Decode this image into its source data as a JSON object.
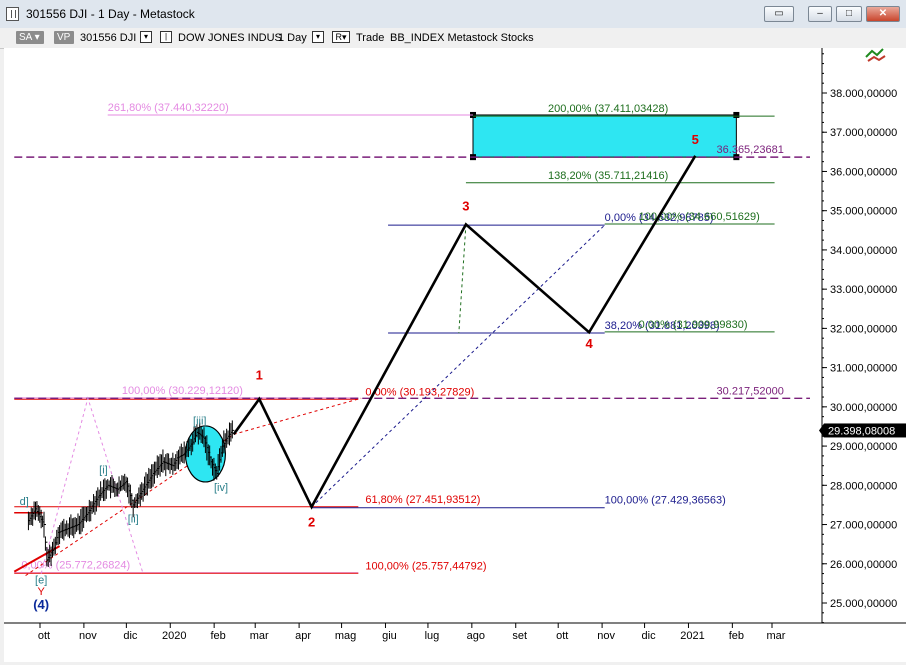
{
  "window": {
    "title": "301556 DJI - 1 Day - Metastock",
    "buttons": {
      "restore": "▭",
      "minimize": "–",
      "maximize": "□",
      "close": "✕"
    }
  },
  "toolbar": {
    "sa_label": "SA",
    "vp_label": "VP",
    "security": "301556 DJI",
    "security_name": "DOW JONES INDUS",
    "period": "1 Day",
    "r_label": "R",
    "trade_label": "Trade",
    "template": "BB_INDEX Metastock Stocks"
  },
  "colors": {
    "accent_cyan": "#2ee6f2",
    "wave_red": "#e00000",
    "wave_blue": "#0b2a9a",
    "fib_pink": "#e48ae2",
    "fib_green": "#1d6e1d",
    "fib_navy": "#1a1a8c"
  },
  "chart_data": {
    "type": "line",
    "title": "",
    "ylim": [
      24400000,
      39500000
    ],
    "y_ticks": [
      "25.000,00000",
      "26.000,00000",
      "27.000,00000",
      "28.000,00000",
      "29.000,00000",
      "30.000,00000",
      "31.000,00000",
      "32.000,00000",
      "33.000,00000",
      "34.000,00000",
      "35.000,00000",
      "36.000,00000",
      "37.000,00000",
      "38.000,00000"
    ],
    "y_tick_values": [
      25000000,
      26000000,
      27000000,
      28000000,
      29000000,
      30000000,
      31000000,
      32000000,
      33000000,
      34000000,
      35000000,
      36000000,
      37000000,
      38000000
    ],
    "x_ticks": [
      "ott",
      "nov",
      "dic",
      "2020",
      "feb",
      "mar",
      "apr",
      "mag",
      "giu",
      "lug",
      "ago",
      "set",
      "ott",
      "nov",
      "dic",
      "2021",
      "feb",
      "mar"
    ],
    "last_price": "29.398,08008",
    "price_series": [
      [
        "2019-09-20",
        27100000
      ],
      [
        "2019-09-25",
        27400000
      ],
      [
        "2019-10-01",
        27000000
      ],
      [
        "2019-10-03",
        26100000
      ],
      [
        "2019-10-08",
        26400000
      ],
      [
        "2019-10-11",
        26800000
      ],
      [
        "2019-10-18",
        26900000
      ],
      [
        "2019-10-25",
        27000000
      ],
      [
        "2019-11-01",
        27300000
      ],
      [
        "2019-11-08",
        27700000
      ],
      [
        "2019-11-15",
        28000000
      ],
      [
        "2019-11-22",
        27900000
      ],
      [
        "2019-11-28",
        28100000
      ],
      [
        "2019-12-03",
        27500000
      ],
      [
        "2019-12-10",
        27900000
      ],
      [
        "2019-12-17",
        28300000
      ],
      [
        "2019-12-24",
        28600000
      ],
      [
        "2019-12-31",
        28500000
      ],
      [
        "2020-01-03",
        28700000
      ],
      [
        "2020-01-08",
        28800000
      ],
      [
        "2020-01-14",
        29100000
      ],
      [
        "2020-01-17",
        29350000
      ],
      [
        "2020-01-22",
        29200000
      ],
      [
        "2020-01-27",
        28600000
      ],
      [
        "2020-01-31",
        28300000
      ],
      [
        "2020-02-04",
        29000000
      ],
      [
        "2020-02-07",
        29200000
      ],
      [
        "2020-02-11",
        29400000
      ]
    ],
    "projection_path": [
      [
        "2020-02-12",
        29300000
      ],
      [
        "2020-03-01",
        30200000
      ],
      [
        "2020-04-07",
        27450000
      ],
      [
        "2020-07-25",
        34650000
      ],
      [
        "2020-10-20",
        31900000
      ],
      [
        "2021-01-03",
        36400000
      ]
    ],
    "wave_labels": [
      {
        "text": "1",
        "date": "2020-03-01",
        "value": 30700000,
        "color": "#e00000"
      },
      {
        "text": "2",
        "date": "2020-04-07",
        "value": 26950000,
        "color": "#e00000"
      },
      {
        "text": "3",
        "date": "2020-07-25",
        "value": 35000000,
        "color": "#e00000"
      },
      {
        "text": "4",
        "date": "2020-10-20",
        "value": 31500000,
        "color": "#e00000"
      },
      {
        "text": "5",
        "date": "2021-01-03",
        "value": 36700000,
        "color": "#e00000"
      },
      {
        "text": "(4)",
        "date": "2019-09-29",
        "value": 24850000,
        "color": "#0b2a9a"
      },
      {
        "text": "Y",
        "date": "2019-09-29",
        "value": 25200000,
        "color": "#e00000"
      },
      {
        "text": "[e]",
        "date": "2019-09-29",
        "value": 25500000,
        "color": "#2a7f8a"
      },
      {
        "text": "d]",
        "date": "2019-09-17",
        "value": 27500000,
        "color": "#2a7f8a"
      },
      {
        "text": "[i]",
        "date": "2019-11-12",
        "value": 28300000,
        "color": "#2a7f8a"
      },
      {
        "text": "[ii]",
        "date": "2019-12-03",
        "value": 27050000,
        "color": "#2a7f8a"
      },
      {
        "text": "[iii]",
        "date": "2020-01-19",
        "value": 29550000,
        "color": "#2a7f8a"
      },
      {
        "text": "[iv]",
        "date": "2020-02-03",
        "value": 27850000,
        "color": "#2a7f8a"
      }
    ],
    "fib_levels": [
      {
        "label": "261,80% (37.440,32220)",
        "value": 37440322,
        "color": "#e48ae2",
        "side": "left"
      },
      {
        "label": "200,00% (37.411,03428)",
        "value": 37411034,
        "color": "#1d6e1d",
        "side": "right"
      },
      {
        "label": "36.365,23681",
        "value": 36365236,
        "color": "#7a1f7a",
        "side": "right"
      },
      {
        "label": "138,20% (35.711,21416)",
        "value": 35711214,
        "color": "#1d6e1d",
        "side": "right"
      },
      {
        "label": "0,00% (34.632,98785)",
        "value": 34632988,
        "color": "#1a1a8c",
        "side": "mid"
      },
      {
        "label": "100,00% (34.660,51629)",
        "value": 34660516,
        "color": "#1d6e1d",
        "side": "right"
      },
      {
        "label": "38,20% (31.881,20398)",
        "value": 31881204,
        "color": "#1a1a8c",
        "side": "mid"
      },
      {
        "label": "0,00% (31.909,99830)",
        "value": 31909998,
        "color": "#1d6e1d",
        "side": "right"
      },
      {
        "label": "100,00% (30.229,12120)",
        "value": 30229121,
        "color": "#e48ae2",
        "side": "left"
      },
      {
        "label": "0,00% (30.193,27829)",
        "value": 30193278,
        "color": "#e00000",
        "side": "mid"
      },
      {
        "label": "30.217,52000",
        "value": 30217520,
        "color": "#7a1f7a",
        "side": "right"
      },
      {
        "label": "61,80% (27.451,93512)",
        "value": 27451935,
        "color": "#e00000",
        "side": "mid"
      },
      {
        "label": "100,00% (27.429,36563)",
        "value": 27429366,
        "color": "#1a1a8c",
        "side": "mid"
      },
      {
        "label": "0,00% (25.772,26824)",
        "value": 25772268,
        "color": "#e48ae2",
        "side": "left"
      },
      {
        "label": "100,00% (25.757,44792)",
        "value": 25757448,
        "color": "#e00000",
        "side": "mid"
      }
    ],
    "target_zone": {
      "low": 36365236,
      "high": 37440322,
      "from": "2020-07-30",
      "to": "2021-02-01",
      "color": "#2ee6f2"
    },
    "grid": false,
    "legend": "none"
  }
}
